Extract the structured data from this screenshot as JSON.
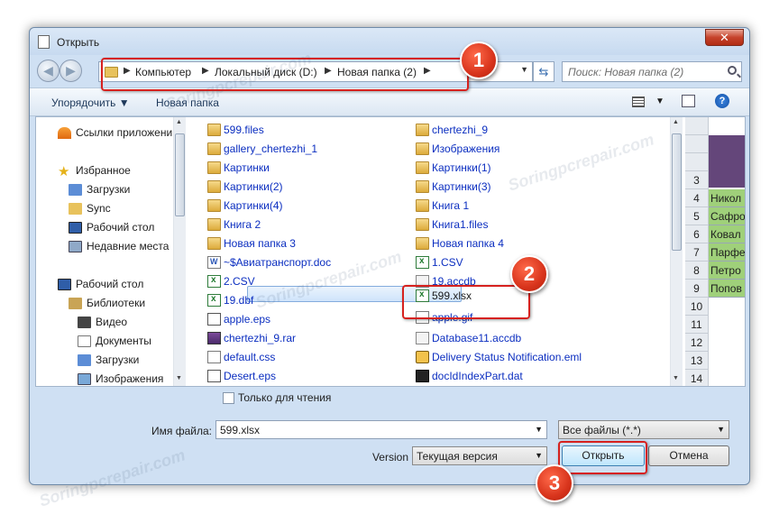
{
  "window": {
    "title": "Открыть",
    "close_label": "✕"
  },
  "address": {
    "crumbs": [
      "Компьютер",
      "Локальный диск (D:)",
      "Новая папка (2)"
    ],
    "search_placeholder": "Поиск: Новая папка (2)"
  },
  "toolbar": {
    "organize": "Упорядочить",
    "new_folder": "Новая папка"
  },
  "nav": {
    "items": [
      "Ссылки приложени",
      "Избранное",
      "Загрузки",
      "Sync",
      "Рабочий стол",
      "Недавние места",
      "Рабочий стол",
      "Библиотеки",
      "Видео",
      "Документы",
      "Загрузки",
      "Изображения"
    ]
  },
  "files": {
    "col1": [
      {
        "name": "599.files",
        "type": "folder"
      },
      {
        "name": "gallery_chertezhi_1",
        "type": "folder"
      },
      {
        "name": "Картинки",
        "type": "folder"
      },
      {
        "name": "Картинки(2)",
        "type": "folder"
      },
      {
        "name": "Картинки(4)",
        "type": "folder"
      },
      {
        "name": "Книга 2",
        "type": "folder"
      },
      {
        "name": "Новая папка 3",
        "type": "folder"
      },
      {
        "name": "~$Авиатранспорт.doc",
        "type": "word"
      },
      {
        "name": "2.CSV",
        "type": "xls"
      },
      {
        "name": "19.dbf",
        "type": "xls"
      },
      {
        "name": "apple.eps",
        "type": "eps"
      },
      {
        "name": "chertezhi_9.rar",
        "type": "rar"
      },
      {
        "name": "default.css",
        "type": "doc"
      },
      {
        "name": "Desert.eps",
        "type": "eps"
      }
    ],
    "col2": [
      {
        "name": "chertezhi_9",
        "type": "folder"
      },
      {
        "name": "Изображения",
        "type": "folder"
      },
      {
        "name": "Картинки(1)",
        "type": "folder"
      },
      {
        "name": "Картинки(3)",
        "type": "folder"
      },
      {
        "name": "Книга 1",
        "type": "folder"
      },
      {
        "name": "Книга1.files",
        "type": "folder"
      },
      {
        "name": "Новая папка 4",
        "type": "folder"
      },
      {
        "name": "1.CSV",
        "type": "xls"
      },
      {
        "name": "19.accdb",
        "type": "db"
      },
      {
        "name": "599.xlsx",
        "type": "xls"
      },
      {
        "name": "apple.gif",
        "type": "doc"
      },
      {
        "name": "Database11.accdb",
        "type": "db"
      },
      {
        "name": "Delivery Status Notification.eml",
        "type": "eml"
      },
      {
        "name": "docIdIndexPart.dat",
        "type": "dat"
      }
    ],
    "selected": "599.xlsx"
  },
  "excel": {
    "rows": [
      "3",
      "4",
      "5",
      "6",
      "7",
      "8",
      "9",
      "10",
      "11",
      "12",
      "13",
      "14"
    ],
    "cells": [
      "",
      "Никол",
      "Сафро",
      "Ковал",
      "Парфе",
      "Петро",
      "Попов",
      "",
      "",
      "",
      "",
      ""
    ]
  },
  "readonly_label": "Только для чтения",
  "filename": {
    "label": "Имя файла:",
    "value": "599.xlsx"
  },
  "filetype": {
    "value": "Все файлы (*.*)"
  },
  "version": {
    "label": "Version",
    "value": "Текущая версия"
  },
  "buttons": {
    "open": "Открыть",
    "cancel": "Отмена"
  },
  "badges": [
    "1",
    "2",
    "3"
  ],
  "watermark": "Soringpcrepair.com",
  "colors": {
    "highlight": "#d6211e",
    "link": "#0b2ec0",
    "excel_green": "#9fd07a",
    "excel_header": "#64467a"
  }
}
